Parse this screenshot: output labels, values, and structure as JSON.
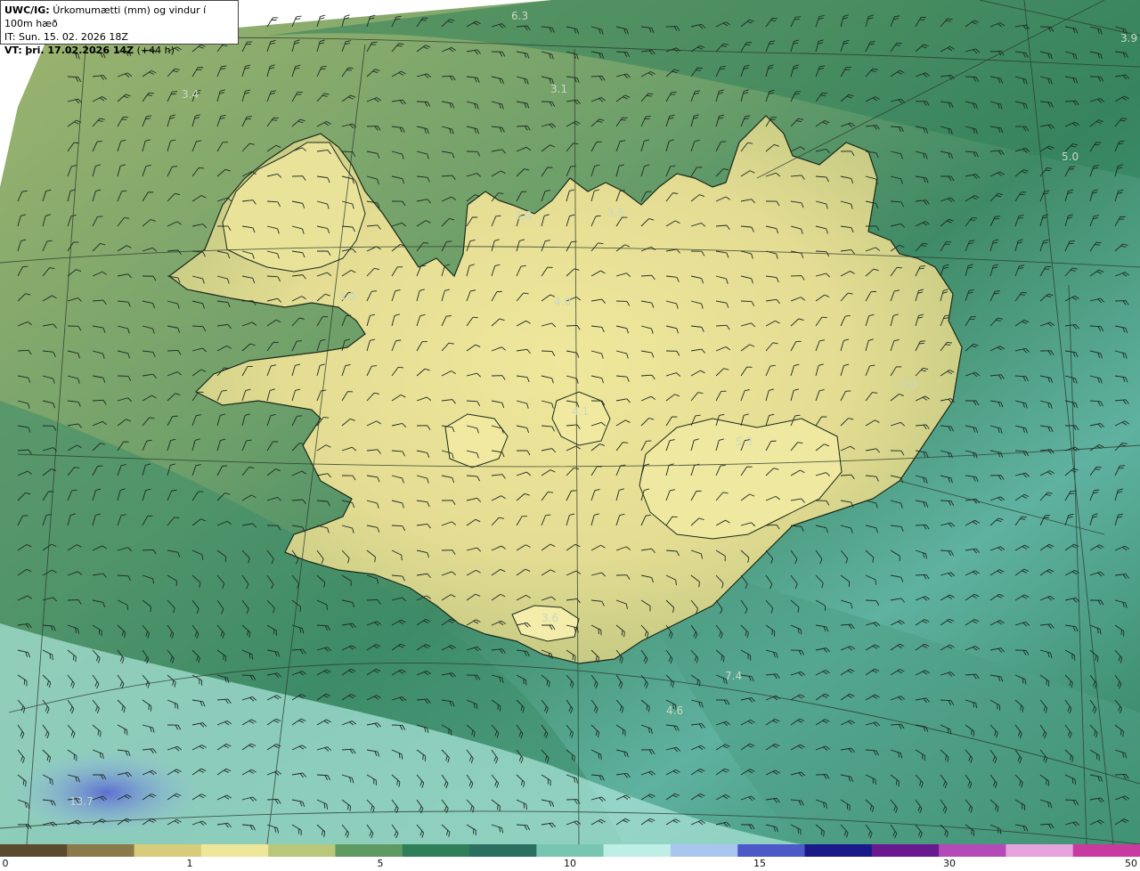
{
  "header": {
    "model": "UWC/IG:",
    "title": "Úrkomumætti (mm) og vindur í 100m hæð",
    "it_line": "IT: Sun. 15. 02. 2026 18Z",
    "vt_label": "VT:",
    "vt_value": "þri. 17.02.2026 14Z",
    "vt_offset": "(+44 h)"
  },
  "map_values": [
    "6.3",
    "3.9",
    "3.4",
    "3.1",
    "5.0",
    "3.8",
    "3.5",
    "3.0",
    "4.0",
    "3.0",
    "4.1",
    "5.3",
    "3.6",
    "7.4",
    "4.6",
    "13.7"
  ],
  "colors": {
    "sea_dark": "#2f7f5a",
    "land_light": "#eee79a",
    "water_light": "#bfeee6",
    "precip_blue": "#5c6fd0",
    "coast": "#1a2a1a",
    "barb": "#1e2a22"
  },
  "scale": {
    "ticks": [
      "0",
      "1",
      "5",
      "10",
      "15",
      "30",
      "50"
    ],
    "colors": [
      "#5a4a2e",
      "#8a7a4a",
      "#d7cc7a",
      "#eee79a",
      "#b8c77a",
      "#5f9a62",
      "#2f7f5a",
      "#2a6f60",
      "#78c6b2",
      "#bfeee6",
      "#a9c6ef",
      "#4d58c9",
      "#1b1a8a",
      "#6a1a8f",
      "#b44ab8",
      "#e7a3de",
      "#c93aa0"
    ]
  }
}
